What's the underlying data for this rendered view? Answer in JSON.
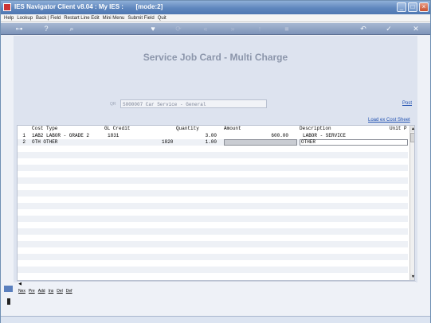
{
  "window": {
    "title": "IES Navigator Client v8.04 : My IES :       [mode:2]"
  },
  "menubar": {
    "items": [
      "Help",
      "Lookup",
      "Back | Field",
      "Restart Line Edit",
      "Mini Menu",
      "Submit Field",
      "Quit"
    ]
  },
  "toolbar": {
    "icons": [
      "key-icon",
      "help-icon",
      "search-icon",
      "heart-icon",
      "refresh-icon",
      "rewind-icon",
      "fast-forward-icon",
      "up-icon",
      "stop-icon",
      "back-icon",
      "check-icon",
      "close-icon"
    ]
  },
  "page": {
    "title": "Service Job Card - Multi Charge",
    "selector_prefix": "QR",
    "selector_value": "S000007 Car Service - General",
    "post_link": "Post",
    "load_link": "Load ex Cost Sheet"
  },
  "grid": {
    "headers": {
      "cost_type": "Cost Type",
      "gl_credit": "GL Credit",
      "quantity": "Quantity",
      "amount": "Amount",
      "description": "Description",
      "unit_price": "Unit P"
    },
    "rows": [
      {
        "num": "1",
        "cost_type": "1AB2 LABOR - GRADE 2",
        "gl_credit": "1831",
        "quantity": "3.00",
        "amount": "600.00",
        "description": "LABOR - SERVICE"
      },
      {
        "num": "2",
        "cost_type": "OTH OTHER",
        "gl_credit": "1820",
        "quantity": "1.00",
        "amount": "",
        "description": "OTHER"
      }
    ]
  },
  "bottom_menu": {
    "items": [
      "Nex",
      "Pre",
      "Add",
      "Ins",
      "Del",
      "Def"
    ]
  }
}
